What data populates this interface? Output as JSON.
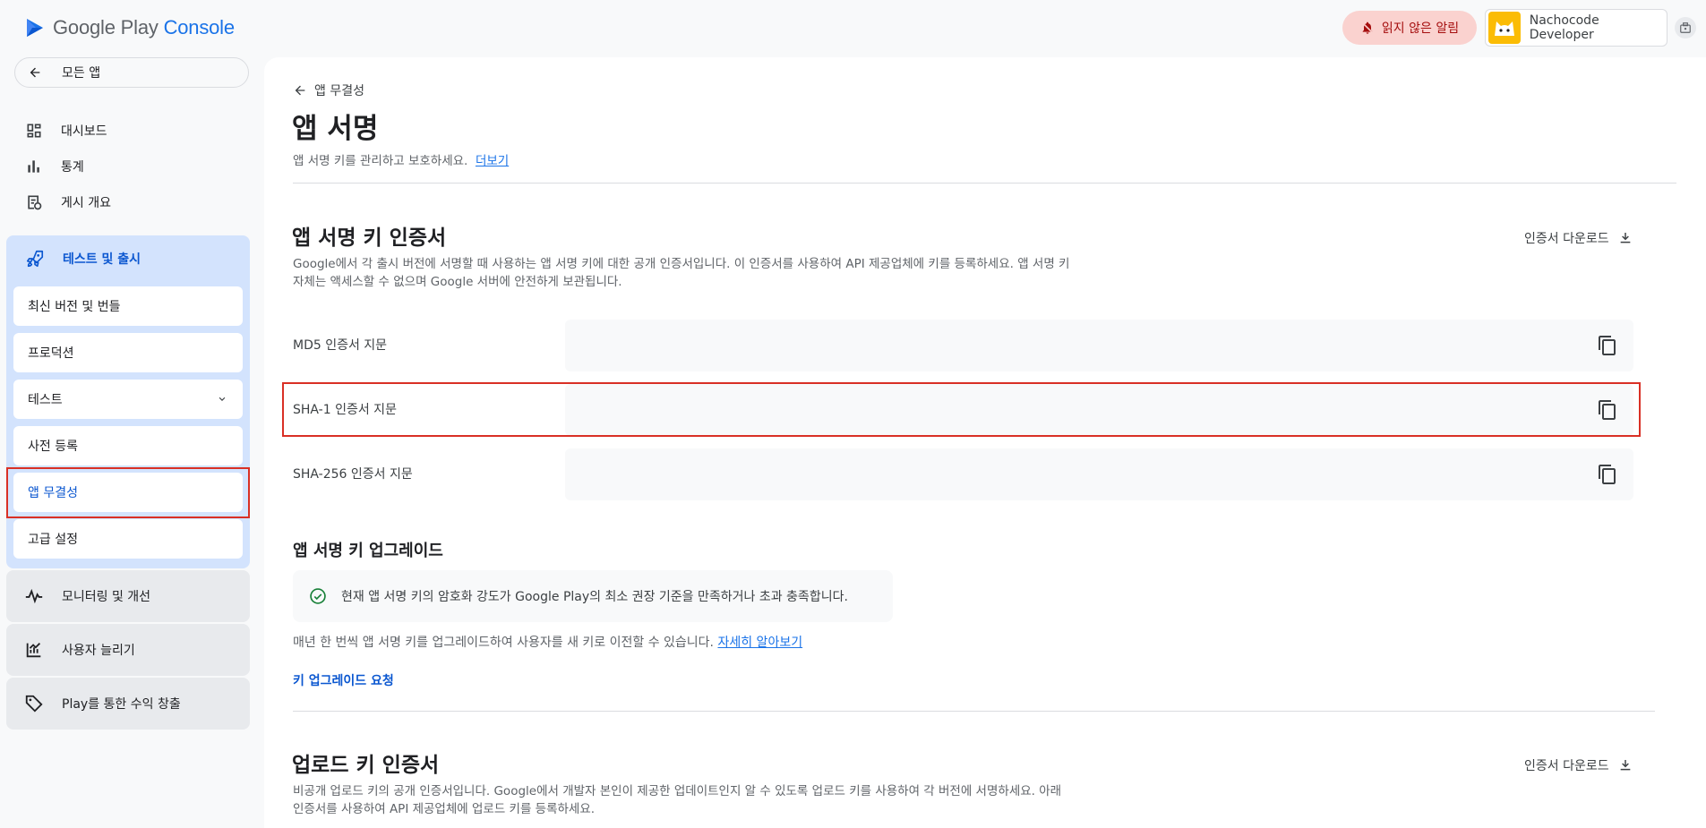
{
  "app": {
    "logo_name": "Google Play",
    "logo_console": "Console",
    "notification_label": "읽지 않은 알림",
    "account_name": "Nachocode Developer"
  },
  "sidebar": {
    "all_apps": "모든 앱",
    "items": [
      {
        "label": "대시보드",
        "icon": "dashboard-icon"
      },
      {
        "label": "통계",
        "icon": "bar-chart-icon"
      },
      {
        "label": "게시 개요",
        "icon": "publishing-overview-icon"
      }
    ],
    "group": {
      "label": "테스트 및 출시",
      "icon": "rocket-icon",
      "children": [
        "최신 버전 및 번들",
        "프로덕션",
        "테스트",
        "사전 등록",
        "앱 무결성",
        "고급 설정"
      ],
      "active": "앱 무결성"
    },
    "categories": [
      {
        "label": "모니터링 및 개선",
        "icon": "pulse-icon"
      },
      {
        "label": "사용자 늘리기",
        "icon": "growth-icon"
      },
      {
        "label": "Play를 통한 수익 창출",
        "icon": "tag-icon"
      }
    ]
  },
  "page": {
    "back_label": "앱 무결성",
    "title": "앱 서명",
    "subtitle": "앱 서명 키를 관리하고 보호하세요.",
    "learn_more": "더보기"
  },
  "signing_cert": {
    "title": "앱 서명 키 인증서",
    "download": "인증서 다운로드",
    "desc_line1": "Google에서 각 출시 버전에 서명할 때 사용하는 앱 서명 키에 대한 공개 인증서입니다. 이 인증서를 사용하여 API 제공업체에 키를 등록하세요. 앱 서명 키",
    "desc_line2": "자체는 액세스할 수 없으며 Google 서버에 안전하게 보관됩니다.",
    "fingerprints": [
      "MD5 인증서 지문",
      "SHA-1 인증서 지문",
      "SHA-256 인증서 지문"
    ]
  },
  "upgrade": {
    "title": "앱 서명 키 업그레이드",
    "status": "현재 앱 서명 키의 암호화 강도가 Google Play의 최소 권장 기준을 만족하거나 초과 충족합니다.",
    "annual": "매년 한 번씩 앱 서명 키를 업그레이드하여 사용자를 새 키로 이전할 수 있습니다.",
    "annual_link": "자세히 알아보기",
    "request": "키 업그레이드 요청"
  },
  "upload_cert": {
    "title": "업로드 키 인증서",
    "download": "인증서 다운로드",
    "desc_line1": "비공개 업로드 키의 공개 인증서입니다. Google에서 개발자 본인이 제공한 업데이트인지 알 수 있도록 업로드 키를 사용하여 각 버전에 서명하세요. 아래",
    "desc_line2": "인증서를 사용하여 API 제공업체에 업로드 키를 등록하세요."
  },
  "colors": {
    "accent": "#0b57d0",
    "highlight": "#d93025",
    "success": "#188038"
  }
}
